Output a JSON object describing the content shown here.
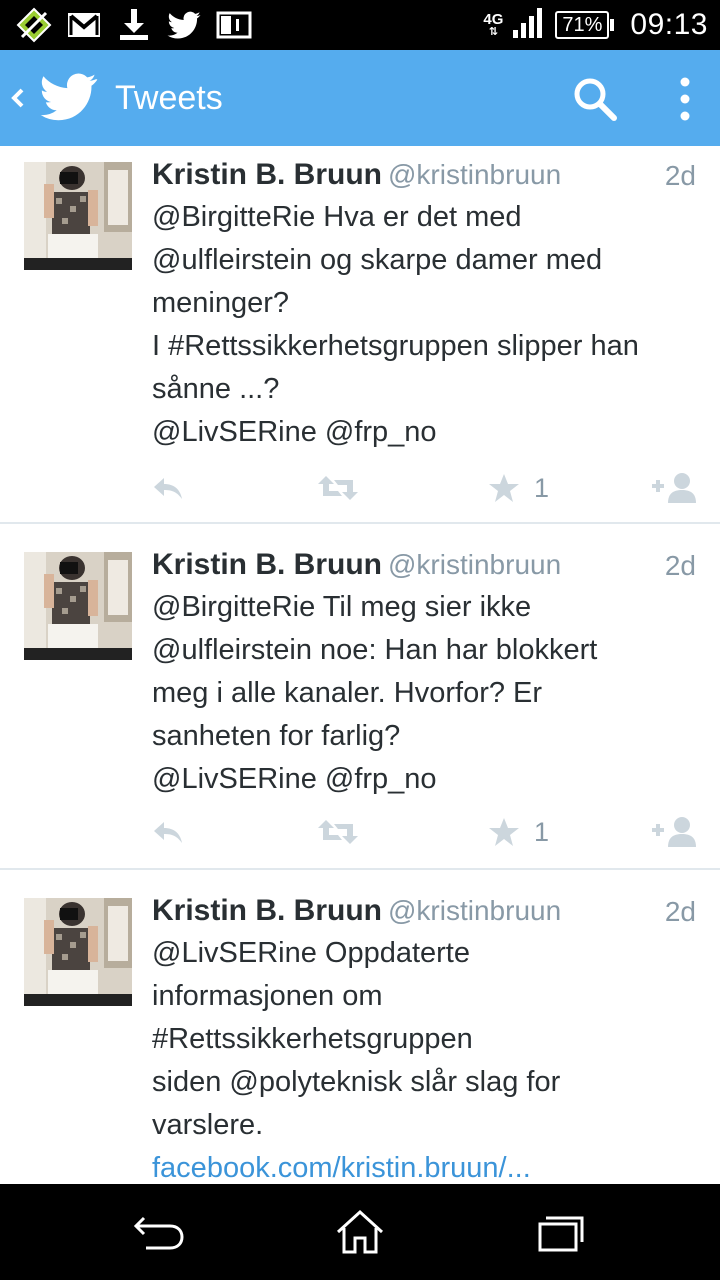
{
  "status_bar": {
    "network": "4G",
    "battery": "71%",
    "time": "09:13",
    "icons": [
      "app-notification-icon",
      "gmail-icon",
      "download-icon",
      "twitter-icon",
      "image-icon"
    ]
  },
  "app_bar": {
    "title": "Tweets",
    "accent_color": "#55acee"
  },
  "tweets": [
    {
      "name": "Kristin B. Bruun",
      "handle": "@kristinbruun",
      "time": "2d",
      "text": "@BirgitteRie Hva er det med\n@ulfleirstein og skarpe damer med\nmeninger?\nI #Rettssikkerhetsgruppen slipper han\nsånne ...?\n@LivSERine @frp_no",
      "favorites": "1"
    },
    {
      "name": "Kristin B. Bruun",
      "handle": "@kristinbruun",
      "time": "2d",
      "text": "@BirgitteRie Til meg sier ikke\n @ulfleirstein noe: Han har blokkert\nmeg i alle kanaler. Hvorfor? Er\nsanheten for farlig?\n@LivSERine @frp_no",
      "favorites": "1"
    },
    {
      "name": "Kristin B. Bruun",
      "handle": "@kristinbruun",
      "time": "2d",
      "text": "@LivSERine Oppdaterte\ninformasjonen om\n#Rettssikkerhetsgruppen\nsiden @polyteknisk slår slag for\nvarslere.",
      "link": "facebook.com/kristin.bruun/..."
    }
  ],
  "colors": {
    "link": "#3b94d9",
    "secondary_text": "#8899a6",
    "action_icon": "#ccd6dd"
  }
}
